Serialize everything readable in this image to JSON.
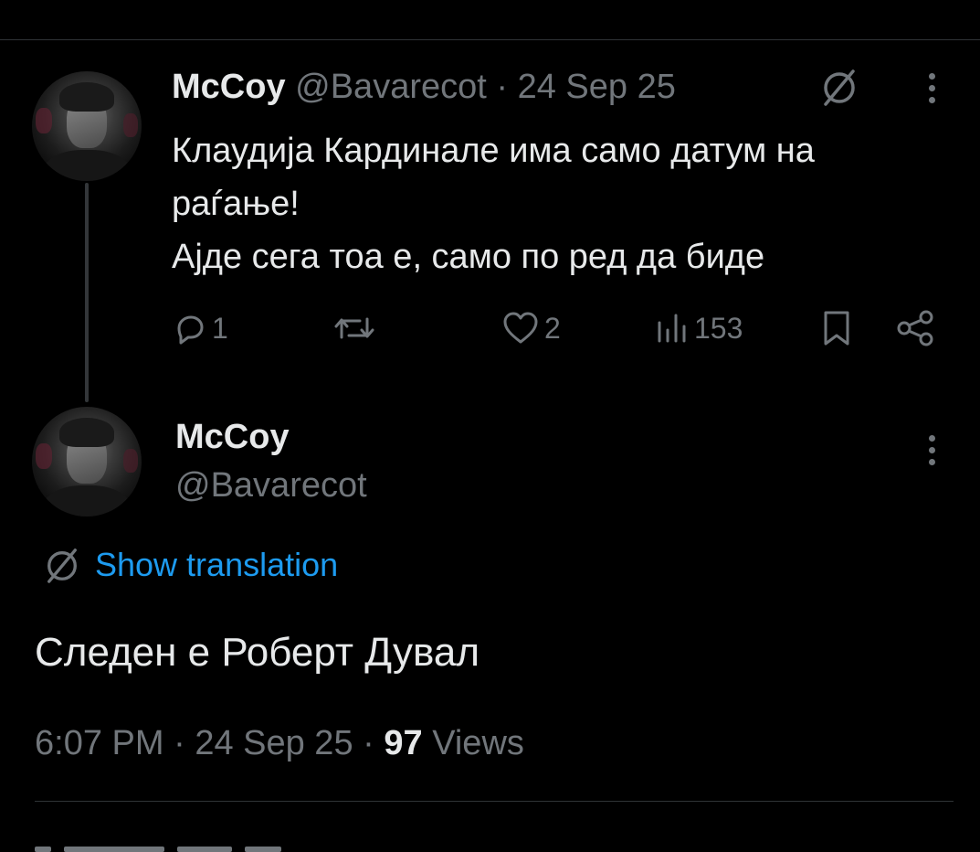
{
  "parent_tweet": {
    "display_name": "McCoy",
    "handle": "@Bavarecot",
    "separator": "·",
    "date": "24 Sep 25",
    "text_lines": [
      "Клаудија Кардинале има само датум на",
      "раѓање!",
      "Ајде сега тоа е, само по ред да биде"
    ],
    "actions": {
      "reply_count": "1",
      "repost_count": "",
      "like_count": "2",
      "views_count": "153"
    }
  },
  "main_tweet": {
    "display_name": "McCoy",
    "handle": "@Bavarecot",
    "show_translation_label": "Show translation",
    "text": "Следен е Роберт Дувал",
    "time": "6:07 PM",
    "separator": "·",
    "date": "24 Sep 25",
    "views_count": "97",
    "views_label": "Views"
  },
  "icons": {
    "translate": "translate-icon",
    "more": "more-vertical-icon",
    "reply": "reply-icon",
    "repost": "repost-icon",
    "like": "heart-icon",
    "views": "views-bar-chart-icon",
    "bookmark": "bookmark-icon",
    "share": "share-icon"
  },
  "colors": {
    "background": "#000000",
    "text": "#e7e9ea",
    "muted": "#71767b",
    "accent": "#1d9bf0",
    "divider": "#2f3336"
  }
}
